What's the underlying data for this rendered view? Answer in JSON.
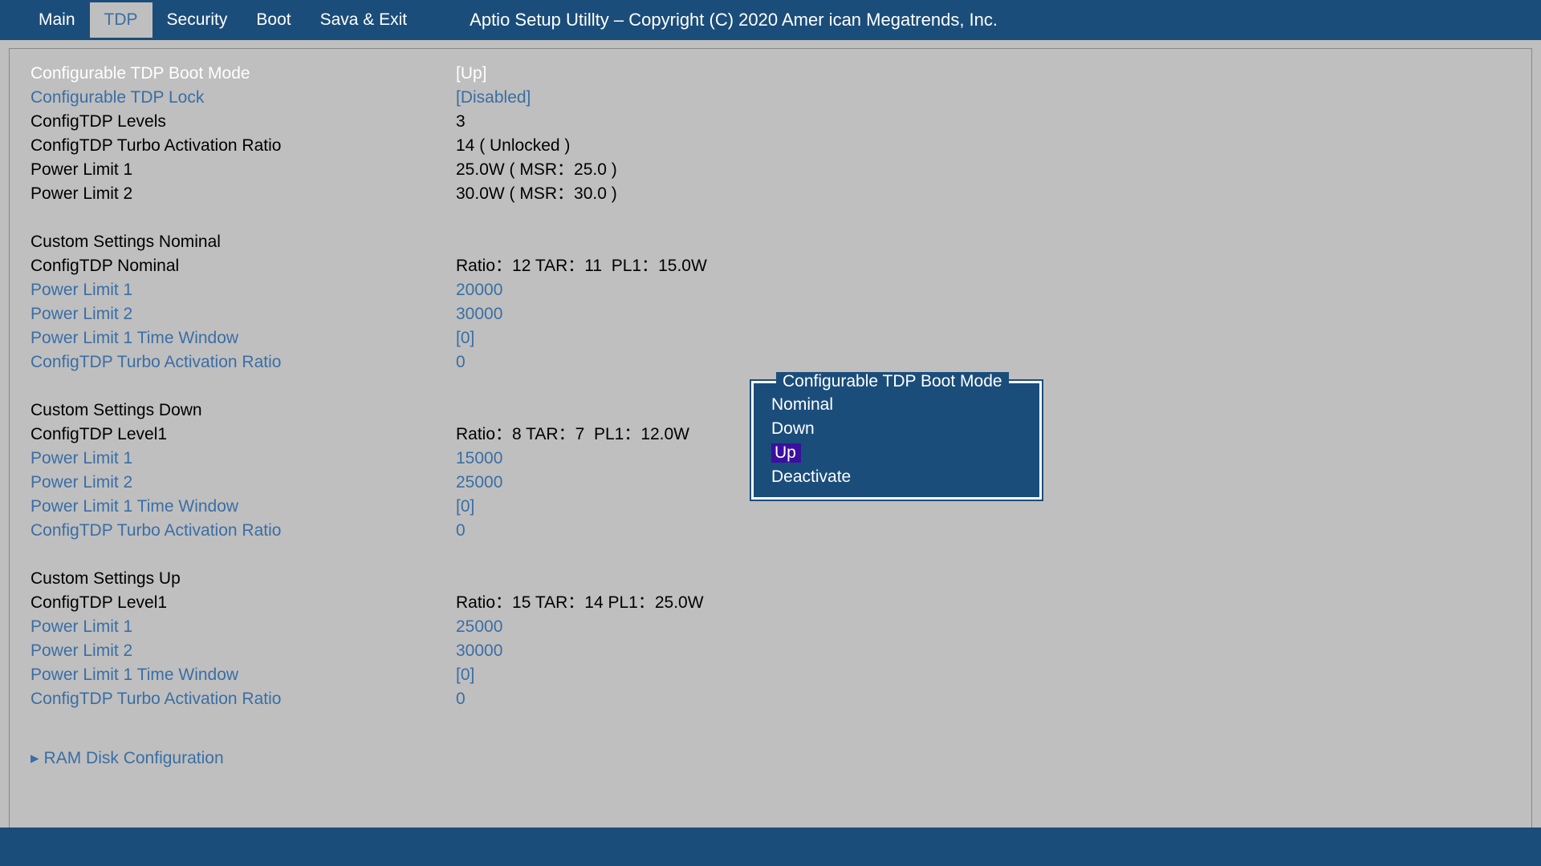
{
  "header": {
    "title": "Aptio Setup Utillty – Copyright (C) 2020 Amer ican Megatrends, Inc.",
    "tabs": [
      "Main",
      "TDP",
      "Security",
      "Boot",
      "Sava & Exit"
    ],
    "active_tab": "TDP"
  },
  "rows": {
    "boot_mode": {
      "label": "Configurable TDP Boot Mode",
      "value": "[Up]"
    },
    "tdp_lock": {
      "label": "Configurable TDP Lock",
      "value": "[Disabled]"
    },
    "levels": {
      "label": "ConfigTDP Levels",
      "value": "3"
    },
    "tar": {
      "label": "ConfigTDP Turbo Activation Ratio",
      "value": "14 ( Unlocked )"
    },
    "pl1": {
      "label": "Power Limit 1",
      "value": "25.0W ( MSR：25.0 )"
    },
    "pl2": {
      "label": "Power Limit 2",
      "value": "30.0W ( MSR：30.0 )"
    },
    "nom_hdr": {
      "label": "Custom Settings Nominal"
    },
    "nom_cfg": {
      "label": "ConfigTDP Nominal",
      "value": "Ratio：12 TAR：11  PL1：15.0W"
    },
    "nom_pl1": {
      "label": "Power Limit 1",
      "value": "20000"
    },
    "nom_pl2": {
      "label": "Power Limit 2",
      "value": "30000"
    },
    "nom_pl1t": {
      "label": "Power Limit 1 Time Window",
      "value": "[0]"
    },
    "nom_tar": {
      "label": "ConfigTDP Turbo Activation Ratio",
      "value": "0"
    },
    "dn_hdr": {
      "label": "Custom Settings Down"
    },
    "dn_cfg": {
      "label": "ConfigTDP Level1",
      "value": "Ratio：8 TAR：7  PL1：12.0W"
    },
    "dn_pl1": {
      "label": "Power Limit 1",
      "value": "15000"
    },
    "dn_pl2": {
      "label": "Power Limit 2",
      "value": "25000"
    },
    "dn_pl1t": {
      "label": "Power Limit 1 Time Window",
      "value": "[0]"
    },
    "dn_tar": {
      "label": "ConfigTDP Turbo Activation Ratio",
      "value": "0"
    },
    "up_hdr": {
      "label": "Custom Settings Up"
    },
    "up_cfg": {
      "label": "ConfigTDP Level1",
      "value": "Ratio：15 TAR：14 PL1：25.0W"
    },
    "up_pl1": {
      "label": "Power Limit 1",
      "value": "25000"
    },
    "up_pl2": {
      "label": "Power Limit 2",
      "value": "30000"
    },
    "up_pl1t": {
      "label": "Power Limit 1 Time Window",
      "value": "[0]"
    },
    "up_tar": {
      "label": "ConfigTDP Turbo Activation Ratio",
      "value": "0"
    },
    "ram": {
      "label": "RAM Disk Configuration"
    }
  },
  "popup": {
    "title": "Configurable TDP Boot Mode",
    "options": [
      "Nominal",
      "Down",
      "Up",
      "Deactivate"
    ],
    "selected": "Up"
  }
}
